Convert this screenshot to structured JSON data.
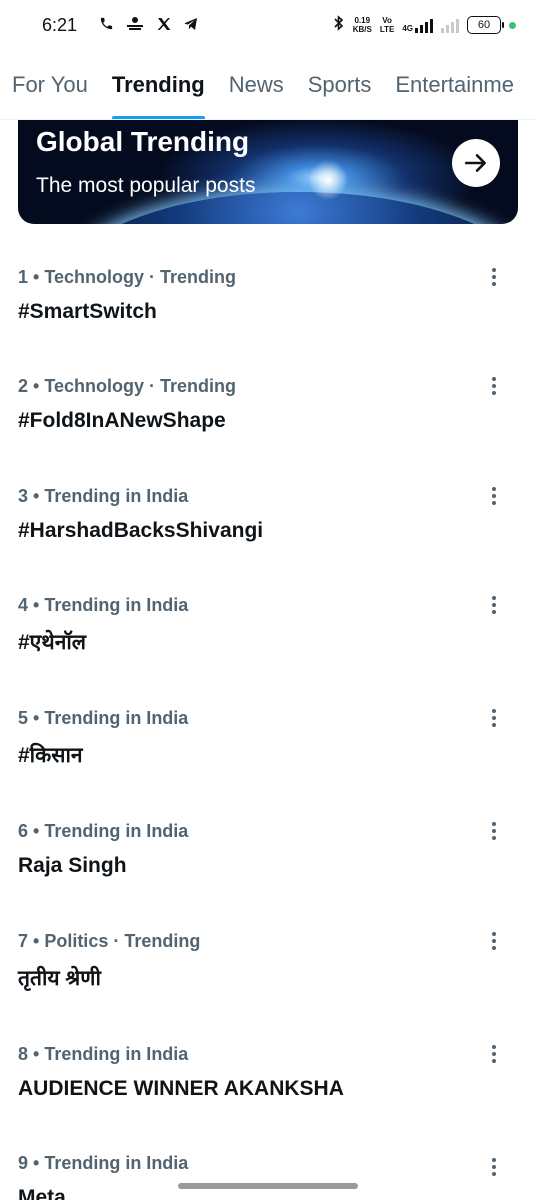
{
  "status_bar": {
    "time": "6:21",
    "left_icons": [
      "phone-icon",
      "news-app-icon",
      "x-logo-icon",
      "telegram-icon"
    ],
    "net_speed": "0.19",
    "net_unit": "KB/S",
    "volte_top": "Vo",
    "volte_bottom": "LTE",
    "network": "4G",
    "battery": "60",
    "dot_color": "#38c172"
  },
  "tabs": [
    {
      "label": "For You",
      "active": false
    },
    {
      "label": "Trending",
      "active": true
    },
    {
      "label": "News",
      "active": false
    },
    {
      "label": "Sports",
      "active": false
    },
    {
      "label": "Entertainme",
      "active": false
    }
  ],
  "banner": {
    "title": "Global Trending",
    "subtitle": "The most popular posts",
    "button_icon": "arrow-right-icon"
  },
  "trends": [
    {
      "meta": "1 • Technology · Trending",
      "name": "#SmartSwitch"
    },
    {
      "meta": "2 • Technology · Trending",
      "name": "#Fold8InANewShape"
    },
    {
      "meta": "3 • Trending in India",
      "name": "#HarshadBacksShivangi"
    },
    {
      "meta": "4 • Trending in India",
      "name": "#एथेनॉल"
    },
    {
      "meta": "5 • Trending in India",
      "name": "#किसान"
    },
    {
      "meta": "6 • Trending in India",
      "name": "Raja Singh"
    },
    {
      "meta": "7 • Politics · Trending",
      "name": "तृतीय श्रेणी"
    },
    {
      "meta": "8 • Trending in India",
      "name": "AUDIENCE WINNER AKANKSHA"
    },
    {
      "meta": "9 • Trending in India",
      "name": "Meta"
    }
  ],
  "colors": {
    "accent": "#1d9bf0",
    "secondary_text": "#536471",
    "primary_text": "#0f1419"
  }
}
